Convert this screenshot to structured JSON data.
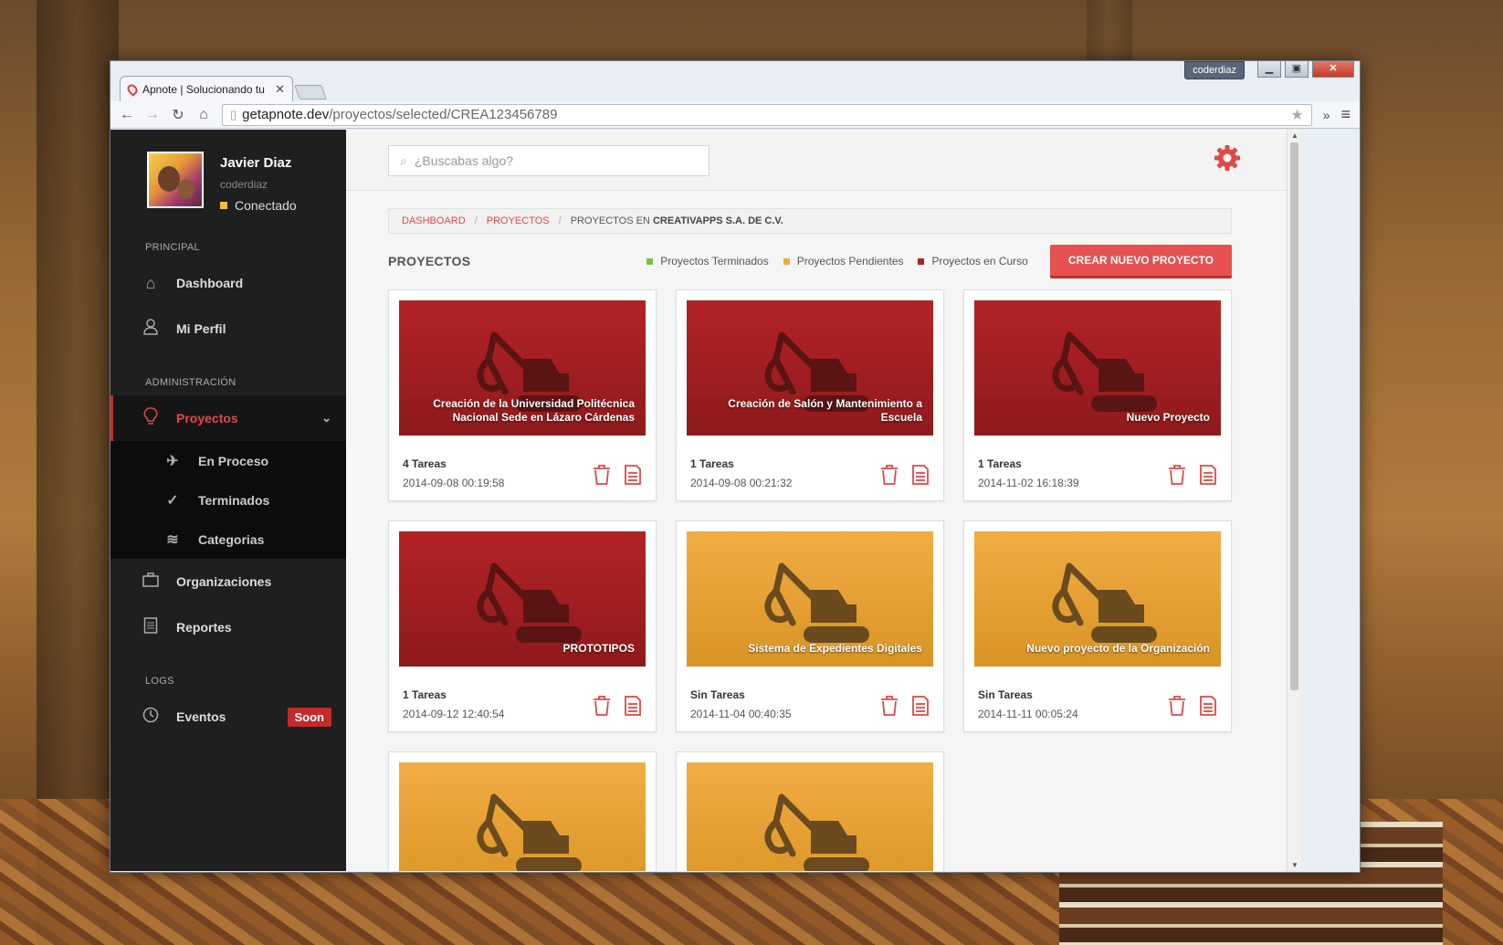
{
  "browser": {
    "tab_title": "Apnote | Solucionando tu",
    "url_host": "getapnote.dev",
    "url_path": "/proyectos/selected/CREA123456789",
    "os_user": "coderdiaz"
  },
  "profile": {
    "name": "Javier Diaz",
    "username": "coderdiaz",
    "status": "Conectado"
  },
  "sidebar": {
    "section_principal": "PRINCIPAL",
    "dashboard": "Dashboard",
    "mi_perfil": "Mi Perfil",
    "section_admin": "ADMINISTRACIÓN",
    "proyectos": "Proyectos",
    "en_proceso": "En Proceso",
    "terminados": "Terminados",
    "categorias": "Categorias",
    "organizaciones": "Organizaciones",
    "reportes": "Reportes",
    "section_logs": "LOGS",
    "eventos": "Eventos",
    "soon": "Soon"
  },
  "search": {
    "placeholder": "¿Buscabas algo?"
  },
  "breadcrumb": {
    "dashboard": "DASHBOARD",
    "proyectos": "PROYECTOS",
    "current_prefix": "PROYECTOS EN",
    "current_org": "CREATIVAPPS S.A. DE C.V."
  },
  "section": {
    "title": "PROYECTOS",
    "legend_done": "Proyectos Terminados",
    "legend_pending": "Proyectos Pendientes",
    "legend_progress": "Proyectos en Curso",
    "create_button": "CREAR NUEVO PROYECTO"
  },
  "colors": {
    "accent": "#e65050",
    "done": "#7cbf4a",
    "pending": "#f0ad40",
    "progress": "#a82626"
  },
  "projects": [
    {
      "title": "Creación de la Universidad Politécnica Nacional Sede en Lázaro Cárdenas",
      "tasks": "4 Tareas",
      "date": "2014-09-08 00:19:58",
      "status": "progress"
    },
    {
      "title": "Creación de Salón y Mantenimiento a Escuela",
      "tasks": "1 Tareas",
      "date": "2014-09-08 00:21:32",
      "status": "progress"
    },
    {
      "title": "Nuevo Proyecto",
      "tasks": "1 Tareas",
      "date": "2014-11-02 16:18:39",
      "status": "progress"
    },
    {
      "title": "PROTOTIPOS",
      "tasks": "1 Tareas",
      "date": "2014-09-12 12:40:54",
      "status": "progress"
    },
    {
      "title": "Sistema de Expedientes Digitales",
      "tasks": "Sin Tareas",
      "date": "2014-11-04 00:40:35",
      "status": "pending"
    },
    {
      "title": "Nuevo proyecto de la Organización",
      "tasks": "Sin Tareas",
      "date": "2014-11-11 00:05:24",
      "status": "pending"
    },
    {
      "title": "",
      "tasks": "",
      "date": "",
      "status": "pending"
    },
    {
      "title": "",
      "tasks": "",
      "date": "",
      "status": "pending"
    }
  ]
}
